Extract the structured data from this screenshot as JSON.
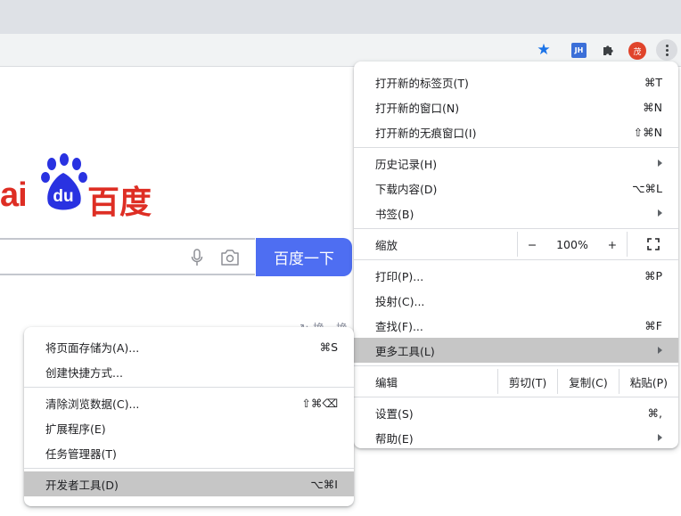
{
  "toolbar": {
    "extension_jh": "JH",
    "profile_initial": "茂"
  },
  "page": {
    "logo_left": "ai",
    "logo_du": "du",
    "logo_cn": "百度",
    "search_button": "百度一下",
    "refresh_text": "换一换"
  },
  "main_menu": {
    "new_tab": {
      "label": "打开新的标签页(T)",
      "shortcut": "⌘T"
    },
    "new_window": {
      "label": "打开新的窗口(N)",
      "shortcut": "⌘N"
    },
    "new_incognito": {
      "label": "打开新的无痕窗口(I)",
      "shortcut": "⇧⌘N"
    },
    "history": {
      "label": "历史记录(H)"
    },
    "downloads": {
      "label": "下载内容(D)",
      "shortcut": "⌥⌘L"
    },
    "bookmarks": {
      "label": "书签(B)"
    },
    "zoom": {
      "label": "缩放",
      "minus": "−",
      "value": "100%",
      "plus": "+"
    },
    "print": {
      "label": "打印(P)...",
      "shortcut": "⌘P"
    },
    "cast": {
      "label": "投射(C)..."
    },
    "find": {
      "label": "查找(F)...",
      "shortcut": "⌘F"
    },
    "more_tools": {
      "label": "更多工具(L)"
    },
    "edit": {
      "label": "编辑",
      "cut": "剪切(T)",
      "copy": "复制(C)",
      "paste": "粘贴(P)"
    },
    "settings": {
      "label": "设置(S)",
      "shortcut": "⌘,"
    },
    "help": {
      "label": "帮助(E)"
    }
  },
  "sub_menu": {
    "save_page": {
      "label": "将页面存储为(A)...",
      "shortcut": "⌘S"
    },
    "create_shortcut": {
      "label": "创建快捷方式..."
    },
    "clear_data": {
      "label": "清除浏览数据(C)...",
      "shortcut": "⇧⌘⌫"
    },
    "extensions": {
      "label": "扩展程序(E)"
    },
    "task_manager": {
      "label": "任务管理器(T)"
    },
    "dev_tools": {
      "label": "开发者工具(D)",
      "shortcut": "⌥⌘I"
    }
  }
}
